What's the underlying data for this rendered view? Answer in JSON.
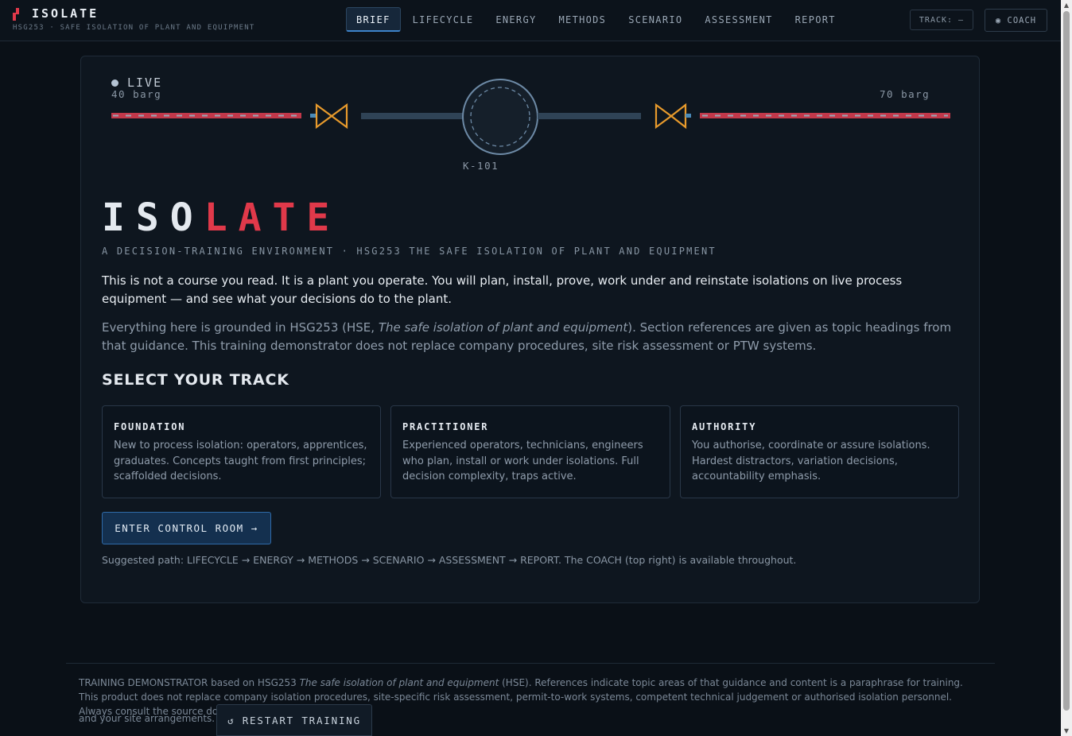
{
  "brand": {
    "title": "ISOLATE",
    "subtitle": "HSG253 · SAFE ISOLATION OF PLANT AND EQUIPMENT"
  },
  "nav": {
    "tabs": [
      {
        "label": "BRIEF",
        "active": true
      },
      {
        "label": "LIFECYCLE",
        "active": false
      },
      {
        "label": "ENERGY",
        "active": false
      },
      {
        "label": "METHODS",
        "active": false
      },
      {
        "label": "SCENARIO",
        "active": false
      },
      {
        "label": "ASSESSMENT",
        "active": false
      },
      {
        "label": "REPORT",
        "active": false
      }
    ],
    "track_label": "TRACK: —",
    "coach_label": "◉ COACH"
  },
  "schematic": {
    "live_label": "LIVE",
    "left_pressure": "40 barg",
    "right_pressure": "70 barg",
    "component_label": "K-101",
    "colors": {
      "live_line": "#c2384a",
      "dead_line": "#2f4356",
      "valve": "#e79a2c"
    }
  },
  "hero": {
    "title_white": "ISO",
    "title_red": "LATE",
    "tagline": "A DECISION-TRAINING ENVIRONMENT · HSG253 THE SAFE ISOLATION OF PLANT AND EQUIPMENT"
  },
  "intro": "This is not a course you read. It is a plant you operate. You will plan, install, prove, work under and reinstate isolations on live process equipment — and see what your decisions do to the plant.",
  "grounded": {
    "before": "Everything here is grounded in HSG253 (HSE, ",
    "italic": "The safe isolation of plant and equipment",
    "after": "). Section references are given as topic headings from that guidance. This training demonstrator does not replace company procedures, site risk assessment or PTW systems."
  },
  "tracks": {
    "title": "SELECT YOUR TRACK",
    "cards": [
      {
        "title": "FOUNDATION",
        "text": "New to process isolation: operators, apprentices, graduates. Concepts taught from first principles; scaffolded decisions."
      },
      {
        "title": "PRACTITIONER",
        "text": "Experienced operators, technicians, engineers who plan, install or work under isolations. Full decision complexity, traps active."
      },
      {
        "title": "AUTHORITY",
        "text": "You authorise, coordinate or assure isolations. Hardest distractors, variation decisions, accountability emphasis."
      }
    ]
  },
  "enter_button": "ENTER CONTROL ROOM →",
  "suggested_path": "Suggested path: LIFECYCLE → ENERGY → METHODS → SCENARIO → ASSESSMENT → REPORT. The COACH (top right) is available throughout.",
  "footer": {
    "before": "TRAINING DEMONSTRATOR based on HSG253 ",
    "italic": "The safe isolation of plant and equipment",
    "after": " (HSE). References indicate topic areas of that guidance and content is a paraphrase for training. This product does not replace company isolation procedures, site-specific risk assessment, permit-to-work systems, competent technical judgement or authorised isolation personnel. Always consult the source document",
    "tail": "and your site arrangements.",
    "restart_label": "↺ RESTART TRAINING"
  }
}
